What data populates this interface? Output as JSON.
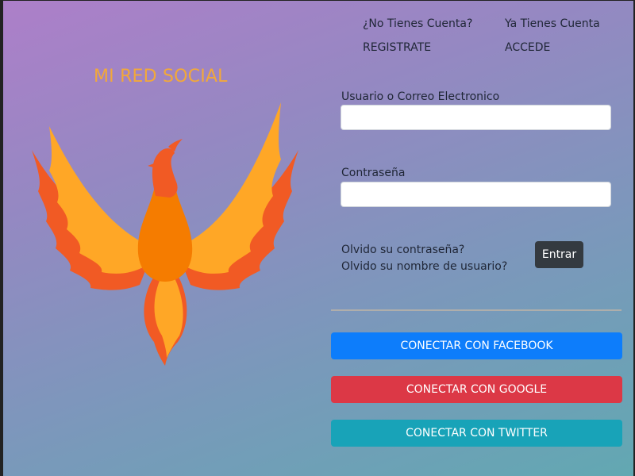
{
  "brand": {
    "title": "MI RED SOCIAL",
    "logo_icon": "phoenix-icon"
  },
  "account_links": {
    "register_question": "¿No Tienes Cuenta?",
    "register_label": "REGISTRATE",
    "login_question": "Ya Tienes Cuenta",
    "login_label": "ACCEDE"
  },
  "form": {
    "user_label": "Usuario o Correo Electronico",
    "user_value": "",
    "user_placeholder": "",
    "password_label": "Contraseña",
    "password_value": "",
    "password_placeholder": "",
    "forgot_password": "Olvido su contraseña?",
    "forgot_username": "Olvido su nombre de usuario?",
    "submit_label": "Entrar"
  },
  "social": {
    "facebook_label": "CONECTAR CON FACEBOOK",
    "google_label": "CONECTAR CON GOOGLE",
    "twitter_label": "CONECTAR CON TWITTER"
  },
  "colors": {
    "brand_orange": "#f2a83a",
    "facebook": "#0d7dfb",
    "google": "#dc3846",
    "twitter": "#18a3b8",
    "submit": "#343a40"
  }
}
